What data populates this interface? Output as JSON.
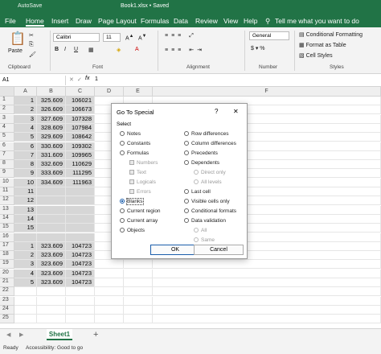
{
  "titlebar": {
    "autosave": "AutoSave",
    "title": "Book1.xlsx • Saved"
  },
  "menu": [
    "File",
    "Home",
    "Insert",
    "Draw",
    "Page Layout",
    "Formulas",
    "Data",
    "Review",
    "View",
    "Help"
  ],
  "tell_me": "Tell me what you want to do",
  "ribbon": {
    "paste": "Paste",
    "clipboard": "Clipboard",
    "font_name": "Calibri",
    "font_size": "11",
    "font": "Font",
    "alignment": "Alignment",
    "number_format": "General",
    "number": "Number",
    "cond_format": "Conditional Formatting",
    "format_table": "Format as Table",
    "cell_styles": "Cell Styles",
    "styles": "Styles"
  },
  "formula_bar": {
    "namebox": "A1",
    "fx": "fx",
    "value": "1"
  },
  "columns": [
    "A",
    "B",
    "C",
    "D",
    "E",
    "F"
  ],
  "rows": [
    [
      "1",
      "1",
      "325.609",
      "106021"
    ],
    [
      "2",
      "2",
      "326.609",
      "106673"
    ],
    [
      "3",
      "3",
      "327.609",
      "107328"
    ],
    [
      "4",
      "4",
      "328.609",
      "107984"
    ],
    [
      "5",
      "5",
      "329.609",
      "108642"
    ],
    [
      "6",
      "6",
      "330.609",
      "109302"
    ],
    [
      "7",
      "7",
      "331.609",
      "109965"
    ],
    [
      "8",
      "8",
      "332.609",
      "110629"
    ],
    [
      "9",
      "9",
      "333.609",
      "111295"
    ],
    [
      "10",
      "10",
      "334.609",
      "111963"
    ],
    [
      "11",
      "11",
      "",
      ""
    ],
    [
      "12",
      "12",
      "",
      ""
    ],
    [
      "13",
      "13",
      "",
      ""
    ],
    [
      "14",
      "14",
      "",
      ""
    ],
    [
      "15",
      "15",
      "",
      ""
    ],
    [
      "16",
      "",
      "",
      ""
    ],
    [
      "17",
      "1",
      "323.609",
      "104723"
    ],
    [
      "18",
      "2",
      "323.609",
      "104723"
    ],
    [
      "19",
      "3",
      "323.609",
      "104723"
    ],
    [
      "20",
      "4",
      "323.609",
      "104723"
    ],
    [
      "21",
      "5",
      "323.609",
      "104723"
    ],
    [
      "22",
      "",
      "",
      ""
    ],
    [
      "23",
      "",
      "",
      ""
    ],
    [
      "24",
      "",
      "",
      ""
    ],
    [
      "25",
      "",
      "",
      ""
    ]
  ],
  "sheet_tab": "Sheet1",
  "status": {
    "ready": "Ready",
    "accessibility": "Accessibility: Good to go"
  },
  "dialog": {
    "title": "Go To Special",
    "help": "?",
    "close": "✕",
    "select": "Select",
    "left": [
      "Notes",
      "Constants",
      "Formulas",
      "Numbers",
      "Text",
      "Logicals",
      "Errors",
      "Blanks",
      "Current region",
      "Current array",
      "Objects"
    ],
    "right": [
      "Row differences",
      "Column differences",
      "Precedents",
      "Dependents",
      "Direct only",
      "All levels",
      "Last cell",
      "Visible cells only",
      "Conditional formats",
      "Data validation",
      "All",
      "Same"
    ],
    "ok": "OK",
    "cancel": "Cancel"
  }
}
